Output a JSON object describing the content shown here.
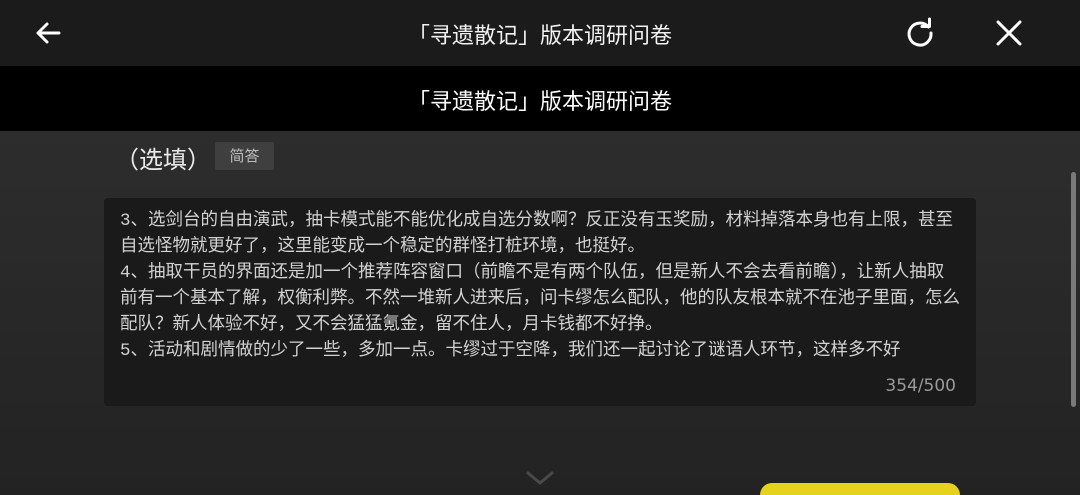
{
  "topbar": {
    "title": "「寻遗散记」版本调研问卷",
    "icons": {
      "back": "arrow-left-icon",
      "refresh": "refresh-icon",
      "close": "close-icon"
    }
  },
  "subheader": {
    "title": "「寻遗散记」版本调研问卷"
  },
  "question": {
    "suffix": "（选填）",
    "type_tag": "简答"
  },
  "answer": {
    "text": "3、选剑台的自由演武，抽卡模式能不能优化成自选分数啊？反正没有玉奖励，材料掉落本身也有上限，甚至自选怪物就更好了，这里能变成一个稳定的群怪打桩环境，也挺好。\n4、抽取干员的界面还是加一个推荐阵容窗口（前瞻不是有两个队伍，但是新人不会去看前瞻），让新人抽取前有一个基本了解，权衡利弊。不然一堆新人进来后，问卡缪怎么配队，他的队友根本就不在池子里面，怎么配队？新人体验不好，又不会猛猛氪金，留不住人，月卡钱都不好挣。\n5、活动和剧情做的少了一些，多加一点。卡缪过于空降，我们还一起讨论了谜语人环节，这样多不好",
    "char_count": "354/500"
  },
  "colors": {
    "accent_yellow": "#e6d21c",
    "topbar_bg": "#1b1b1b",
    "subheader_bg": "#000000"
  }
}
